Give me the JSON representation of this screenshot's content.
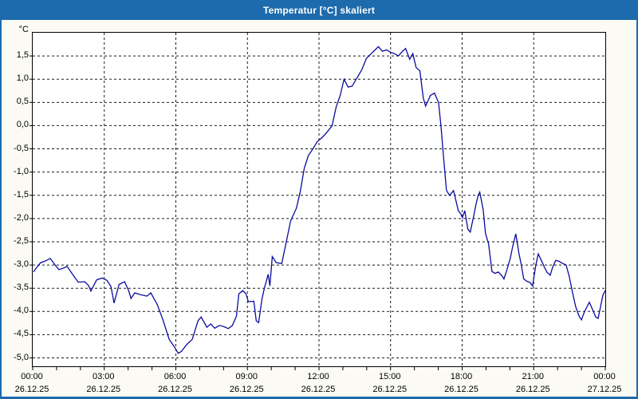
{
  "window": {
    "title": "Temperatur [°C] skaliert"
  },
  "colors": {
    "titlebar_bg": "#1d6bac",
    "window_border": "#1d6bac",
    "title_text": "#ffffff",
    "plot_bg": "#ffffff",
    "margin_bg": "#fbfbf4",
    "grid": "#1a1a1a",
    "axis": "#000000",
    "line": "#0b0b9e"
  },
  "chart_data": {
    "type": "line",
    "title": "Temperatur [°C] skaliert",
    "ylabel": "°C",
    "xlabel": "",
    "xlim_hours": [
      0,
      24
    ],
    "ylim": [
      -5.18,
      2.0
    ],
    "grid": "dashed",
    "legend_position": "none",
    "y_gridline_values": [
      1.5,
      1.0,
      0.5,
      0.0,
      -0.5,
      -1.0,
      -1.5,
      -2.0,
      -2.5,
      -3.0,
      -3.5,
      -4.0,
      -4.5,
      -5.0
    ],
    "y_tick_labels": [
      "1,5",
      "1,0",
      "0,5",
      "0,0",
      "-0,5",
      "-1,0",
      "-1,5",
      "-2,0",
      "-2,5",
      "-3,0",
      "-3,5",
      "-4,0",
      "-4,5",
      "-5,0"
    ],
    "x_major_hours": [
      0,
      3,
      6,
      9,
      12,
      15,
      18,
      21,
      24
    ],
    "x_tick_labels": [
      {
        "time": "00:00",
        "date": "26.12.25"
      },
      {
        "time": "03:00",
        "date": "26.12.25"
      },
      {
        "time": "06:00",
        "date": "26.12.25"
      },
      {
        "time": "09:00",
        "date": "26.12.25"
      },
      {
        "time": "12:00",
        "date": "26.12.25"
      },
      {
        "time": "15:00",
        "date": "26.12.25"
      },
      {
        "time": "18:00",
        "date": "26.12.25"
      },
      {
        "time": "21:00",
        "date": "26.12.25"
      },
      {
        "time": "00:00",
        "date": "27.12.25"
      }
    ],
    "x_minor_tick_step_hours": 1,
    "series": [
      {
        "name": "Temperatur skaliert",
        "color": "#0b0b9e",
        "points": [
          [
            0.03,
            -3.15
          ],
          [
            0.17,
            -3.05
          ],
          [
            0.33,
            -2.95
          ],
          [
            0.5,
            -2.92
          ],
          [
            0.74,
            -2.86
          ],
          [
            0.94,
            -3.0
          ],
          [
            1.1,
            -3.1
          ],
          [
            1.27,
            -3.07
          ],
          [
            1.44,
            -3.03
          ],
          [
            1.67,
            -3.2
          ],
          [
            1.91,
            -3.37
          ],
          [
            2.18,
            -3.36
          ],
          [
            2.34,
            -3.44
          ],
          [
            2.44,
            -3.56
          ],
          [
            2.68,
            -3.32
          ],
          [
            2.91,
            -3.28
          ],
          [
            3.11,
            -3.33
          ],
          [
            3.28,
            -3.46
          ],
          [
            3.41,
            -3.82
          ],
          [
            3.62,
            -3.42
          ],
          [
            3.85,
            -3.36
          ],
          [
            4.02,
            -3.55
          ],
          [
            4.12,
            -3.72
          ],
          [
            4.28,
            -3.6
          ],
          [
            4.52,
            -3.64
          ],
          [
            4.79,
            -3.67
          ],
          [
            4.95,
            -3.6
          ],
          [
            5.22,
            -3.85
          ],
          [
            5.46,
            -4.18
          ],
          [
            5.72,
            -4.6
          ],
          [
            5.96,
            -4.78
          ],
          [
            6.1,
            -4.9
          ],
          [
            6.23,
            -4.86
          ],
          [
            6.46,
            -4.71
          ],
          [
            6.69,
            -4.6
          ],
          [
            6.93,
            -4.2
          ],
          [
            7.06,
            -4.12
          ],
          [
            7.3,
            -4.34
          ],
          [
            7.46,
            -4.27
          ],
          [
            7.63,
            -4.36
          ],
          [
            7.83,
            -4.3
          ],
          [
            8.03,
            -4.33
          ],
          [
            8.2,
            -4.37
          ],
          [
            8.37,
            -4.3
          ],
          [
            8.54,
            -4.1
          ],
          [
            8.64,
            -3.62
          ],
          [
            8.8,
            -3.55
          ],
          [
            8.94,
            -3.62
          ],
          [
            9.04,
            -3.79
          ],
          [
            9.27,
            -3.78
          ],
          [
            9.37,
            -4.2
          ],
          [
            9.47,
            -4.24
          ],
          [
            9.61,
            -3.73
          ],
          [
            9.71,
            -3.5
          ],
          [
            9.87,
            -3.2
          ],
          [
            9.94,
            -3.45
          ],
          [
            10.04,
            -2.82
          ],
          [
            10.21,
            -2.95
          ],
          [
            10.44,
            -2.97
          ],
          [
            10.61,
            -2.55
          ],
          [
            10.81,
            -2.05
          ],
          [
            11.05,
            -1.78
          ],
          [
            11.21,
            -1.43
          ],
          [
            11.38,
            -0.92
          ],
          [
            11.55,
            -0.65
          ],
          [
            11.72,
            -0.52
          ],
          [
            11.92,
            -0.35
          ],
          [
            12.12,
            -0.26
          ],
          [
            12.32,
            -0.15
          ],
          [
            12.55,
            0.0
          ],
          [
            12.72,
            0.4
          ],
          [
            12.89,
            0.65
          ],
          [
            13.05,
            1.0
          ],
          [
            13.22,
            0.83
          ],
          [
            13.39,
            0.85
          ],
          [
            13.56,
            1.0
          ],
          [
            13.79,
            1.2
          ],
          [
            13.99,
            1.45
          ],
          [
            14.19,
            1.55
          ],
          [
            14.39,
            1.65
          ],
          [
            14.49,
            1.7
          ],
          [
            14.66,
            1.6
          ],
          [
            14.83,
            1.63
          ],
          [
            15.0,
            1.58
          ],
          [
            15.16,
            1.55
          ],
          [
            15.33,
            1.5
          ],
          [
            15.5,
            1.6
          ],
          [
            15.63,
            1.66
          ],
          [
            15.8,
            1.43
          ],
          [
            15.93,
            1.55
          ],
          [
            16.07,
            1.25
          ],
          [
            16.23,
            1.18
          ],
          [
            16.37,
            0.6
          ],
          [
            16.47,
            0.42
          ],
          [
            16.67,
            0.65
          ],
          [
            16.84,
            0.7
          ],
          [
            17.01,
            0.5
          ],
          [
            17.11,
            0.0
          ],
          [
            17.24,
            -0.8
          ],
          [
            17.34,
            -1.39
          ],
          [
            17.47,
            -1.5
          ],
          [
            17.64,
            -1.4
          ],
          [
            17.84,
            -1.83
          ],
          [
            17.94,
            -1.9
          ],
          [
            18.01,
            -1.98
          ],
          [
            18.11,
            -1.83
          ],
          [
            18.24,
            -2.23
          ],
          [
            18.34,
            -2.29
          ],
          [
            18.48,
            -1.95
          ],
          [
            18.58,
            -1.69
          ],
          [
            18.68,
            -1.49
          ],
          [
            18.74,
            -1.43
          ],
          [
            18.88,
            -1.8
          ],
          [
            18.98,
            -2.32
          ],
          [
            19.11,
            -2.55
          ],
          [
            19.25,
            -3.14
          ],
          [
            19.38,
            -3.18
          ],
          [
            19.51,
            -3.15
          ],
          [
            19.65,
            -3.22
          ],
          [
            19.75,
            -3.3
          ],
          [
            19.88,
            -3.1
          ],
          [
            20.02,
            -2.85
          ],
          [
            20.12,
            -2.6
          ],
          [
            20.25,
            -2.33
          ],
          [
            20.38,
            -2.75
          ],
          [
            20.48,
            -3.0
          ],
          [
            20.58,
            -3.3
          ],
          [
            20.72,
            -3.35
          ],
          [
            20.85,
            -3.38
          ],
          [
            20.95,
            -3.45
          ],
          [
            21.09,
            -3.0
          ],
          [
            21.19,
            -2.76
          ],
          [
            21.32,
            -2.9
          ],
          [
            21.45,
            -3.05
          ],
          [
            21.55,
            -3.15
          ],
          [
            21.69,
            -3.22
          ],
          [
            21.79,
            -3.05
          ],
          [
            21.92,
            -2.9
          ],
          [
            22.06,
            -2.92
          ],
          [
            22.19,
            -2.96
          ],
          [
            22.36,
            -3.0
          ],
          [
            22.49,
            -3.25
          ],
          [
            22.63,
            -3.6
          ],
          [
            22.76,
            -3.9
          ],
          [
            22.9,
            -4.1
          ],
          [
            23.0,
            -4.18
          ],
          [
            23.13,
            -4.0
          ],
          [
            23.23,
            -3.9
          ],
          [
            23.33,
            -3.8
          ],
          [
            23.46,
            -3.95
          ],
          [
            23.6,
            -4.12
          ],
          [
            23.7,
            -4.15
          ],
          [
            23.8,
            -3.9
          ],
          [
            23.9,
            -3.65
          ],
          [
            24.0,
            -3.55
          ]
        ]
      }
    ]
  }
}
